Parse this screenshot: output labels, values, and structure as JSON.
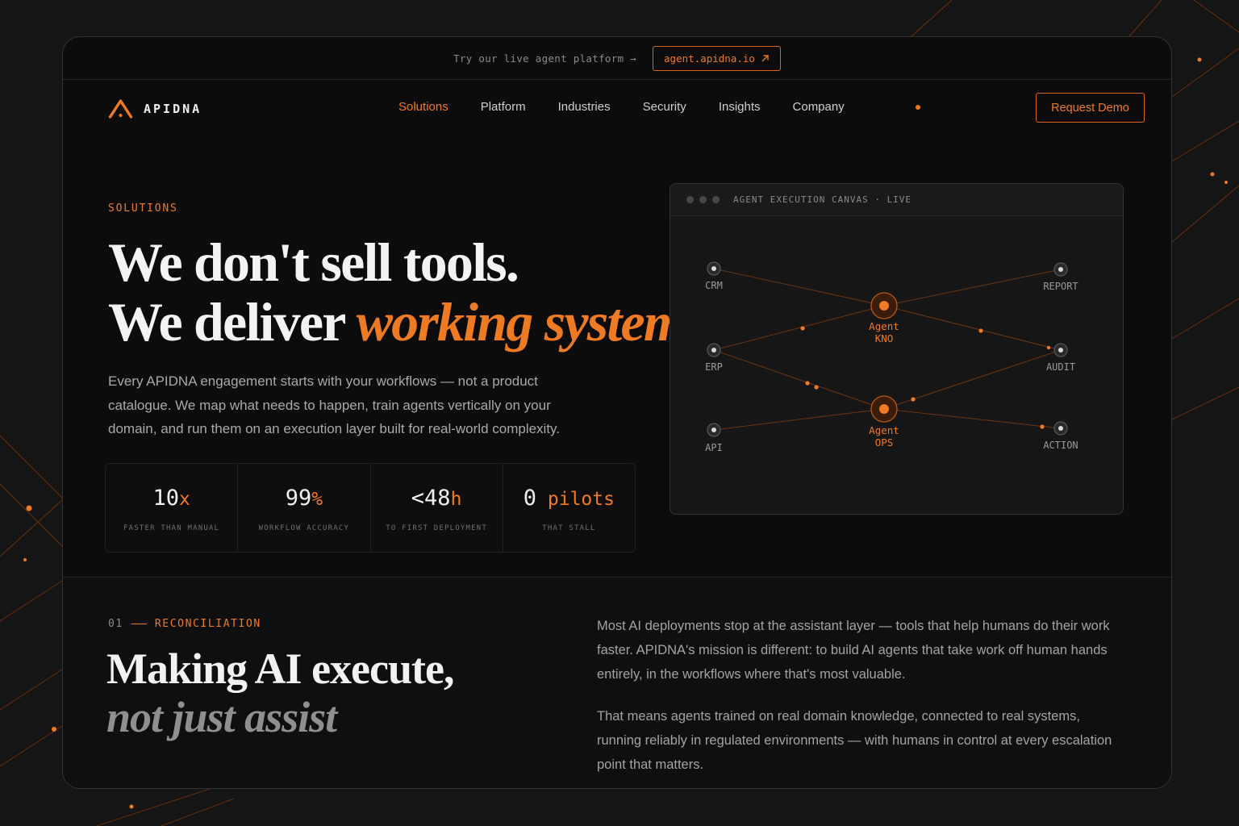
{
  "topbar": {
    "text": "Try our live agent platform →",
    "link_label": "agent.apidna.io"
  },
  "brand": {
    "name": "APIDNA",
    "accent": "#f07a24"
  },
  "nav": {
    "links": [
      "Solutions",
      "Platform",
      "Industries",
      "Security",
      "Insights",
      "Company"
    ],
    "active": "Solutions",
    "cta": "Request Demo"
  },
  "hero": {
    "eyebrow": "SOLUTIONS",
    "line1": "We don't sell tools.",
    "line2_plain": "We deliver ",
    "line2_accent": "working systems.",
    "description": "Every APIDNA engagement starts with your workflows — not a product catalogue. We map what needs to happen, train agents vertically on your domain, and run them on an execution layer built for real-world complexity."
  },
  "stats": [
    {
      "value": "10",
      "unit": "x",
      "label": "FASTER THAN MANUAL"
    },
    {
      "value": "99",
      "unit": "%",
      "label": "WORKFLOW ACCURACY"
    },
    {
      "value": "<48",
      "unit": "h",
      "label": "TO FIRST DEPLOYMENT"
    },
    {
      "value": "0",
      "unit": " pilots",
      "label": "THAT STALL"
    }
  ],
  "canvas": {
    "title": "AGENT EXECUTION CANVAS · LIVE",
    "nodes": {
      "crm": "CRM",
      "erp": "ERP",
      "api": "API",
      "report": "REPORT",
      "audit": "AUDIT",
      "action": "ACTION",
      "agent_kno": [
        "Agent",
        "KNO"
      ],
      "agent_ops": [
        "Agent",
        "OPS"
      ]
    }
  },
  "section": {
    "number": "01",
    "name": "RECONCILIATION",
    "title_line1": "Making AI execute,",
    "title_line2": "not just assist",
    "para1": "Most AI deployments stop at the assistant layer — tools that help humans do their work faster. APIDNA's mission is different: to build AI agents that take work off human hands entirely, in the workflows where that's most valuable.",
    "para2": "That means agents trained on real domain knowledge, connected to real systems, running reliably in regulated environments — with humans in control at every escalation point that matters."
  }
}
